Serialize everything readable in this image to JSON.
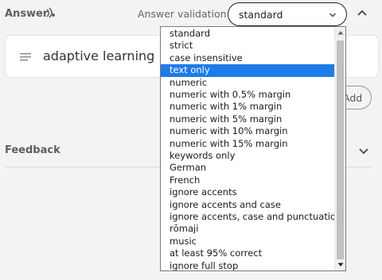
{
  "answer": {
    "title": "Answer",
    "audio_icon": "audio-wave-icon",
    "validation_label": "Answer validation",
    "validation_value": "standard",
    "answer_text": "adaptive learning",
    "add_label": "Add"
  },
  "feedback": {
    "title": "Feedback"
  },
  "dropdown": {
    "selected_index": 3,
    "options": [
      "standard",
      "strict",
      "case insensitive",
      "text only",
      "numeric",
      "numeric with 0.5% margin",
      "numeric with 1% margin",
      "numeric with 5% margin",
      "numeric with 10% margin",
      "numeric with 15% margin",
      "keywords only",
      "German",
      "French",
      "ignore accents",
      "ignore accents and case",
      "ignore accents, case and punctuation",
      "rōmaji",
      "music",
      "at least 95% correct",
      "ignore full stop"
    ]
  },
  "colors": {
    "background": "#f3f3f3",
    "selected_option": "#1e7be8",
    "select_border": "#222222"
  }
}
